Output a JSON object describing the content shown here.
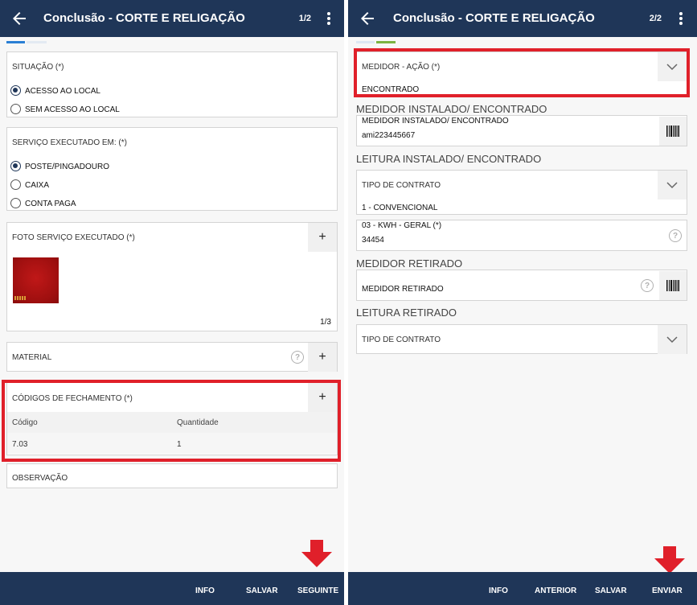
{
  "screen1": {
    "title": "Conclusão - CORTE E RELIGAÇÃO",
    "page": "1/2",
    "situacao": {
      "label": "SITUAÇÃO (*)",
      "options": [
        "ACESSO AO LOCAL",
        "SEM ACESSO AO LOCAL"
      ],
      "selected": "ACESSO AO LOCAL"
    },
    "servico": {
      "label": "SERVIÇO EXECUTADO EM: (*)",
      "options": [
        "POSTE/PINGADOURO",
        "CAIXA",
        "CONTA PAGA"
      ],
      "selected": "POSTE/PINGADOURO"
    },
    "foto": {
      "label": "FOTO SERVIÇO EXECUTADO (*)",
      "add": "+",
      "counter": "1/3"
    },
    "material": {
      "label": "MATERIAL",
      "help": "?",
      "add": "+"
    },
    "codigos": {
      "label": "CÓDIGOS DE FECHAMENTO (*)",
      "add": "+",
      "columns": [
        "Código",
        "Quantidade"
      ],
      "rows": [
        [
          "7.03",
          "1"
        ]
      ]
    },
    "observacao": {
      "label": "OBSERVAÇÃO"
    },
    "bottom": {
      "info": "INFO",
      "salvar": "SALVAR",
      "seguinte": "SEGUINTE"
    }
  },
  "screen2": {
    "title": "Conclusão - CORTE E RELIGAÇÃO",
    "page": "2/2",
    "medidor_acao": {
      "label": "MEDIDOR - AÇÃO (*)",
      "value": "ENCONTRADO"
    },
    "medidor_instalado_section": "MEDIDOR INSTALADO/ ENCONTRADO",
    "medidor_instalado": {
      "label": "MEDIDOR INSTALADO/ ENCONTRADO",
      "value": "ami223445667"
    },
    "leitura_instalado_section": "LEITURA INSTALADO/ ENCONTRADO",
    "tipo_contrato_1": {
      "label": "TIPO DE CONTRATO",
      "value": "1 - CONVENCIONAL"
    },
    "kwh": {
      "label": "03 - KWH - GERAL (*)",
      "value": "34454",
      "help": "?"
    },
    "medidor_retirado_section": "MEDIDOR RETIRADO",
    "medidor_retirado": {
      "placeholder": "MEDIDOR RETIRADO",
      "help": "?"
    },
    "leitura_retirado_section": "LEITURA RETIRADO",
    "tipo_contrato_2": {
      "label": "TIPO DE CONTRATO"
    },
    "bottom": {
      "info": "INFO",
      "anterior": "ANTERIOR",
      "salvar": "SALVAR",
      "enviar": "ENVIAR"
    }
  },
  "colors": {
    "appbar": "#1f3658",
    "highlight": "#e0202a",
    "tab_blue": "#2a7fd4",
    "tab_green": "#7cb342"
  }
}
